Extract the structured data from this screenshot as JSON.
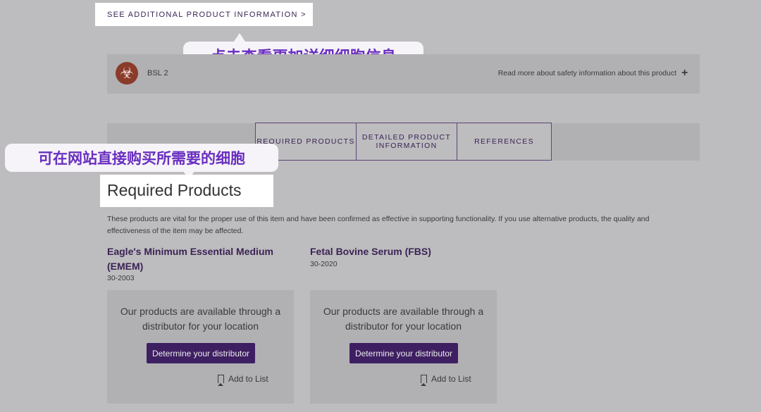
{
  "top_link": "SEE ADDITIONAL PRODUCT INFORMATION >",
  "callouts": {
    "first": "点击查看更加详细细胞信息",
    "second": "可在网站直接购买所需要的细胞"
  },
  "safety": {
    "level": "BSL 2",
    "link": "Read more about safety information about this product",
    "expand": "+",
    "icon": "biohazard-icon"
  },
  "tabs": [
    {
      "label": "REQUIRED PRODUCTS"
    },
    {
      "label": "DETAILED PRODUCT INFORMATION"
    },
    {
      "label": "REFERENCES"
    }
  ],
  "section": {
    "title": "Required Products",
    "description": "These products are vital for the proper use of this item and have been confirmed as effective in supporting functionality. If you use alternative products, the quality and effectiveness of the item may be affected."
  },
  "products": [
    {
      "name": "Eagle's Minimum Essential Medium (EMEM)",
      "sku": "30-2003",
      "availability": "Our products are available through a distributor for your location",
      "button": "Determine your distributor",
      "add_to_list": "Add to List"
    },
    {
      "name": "Fetal Bovine Serum (FBS)",
      "sku": "30-2020",
      "availability": "Our products are available through a distributor for your location",
      "button": "Determine your distributor",
      "add_to_list": "Add to List"
    }
  ],
  "colors": {
    "background": "#bdbcbe",
    "accent": "#3e1f62",
    "callout_text": "#6a2fc0"
  }
}
